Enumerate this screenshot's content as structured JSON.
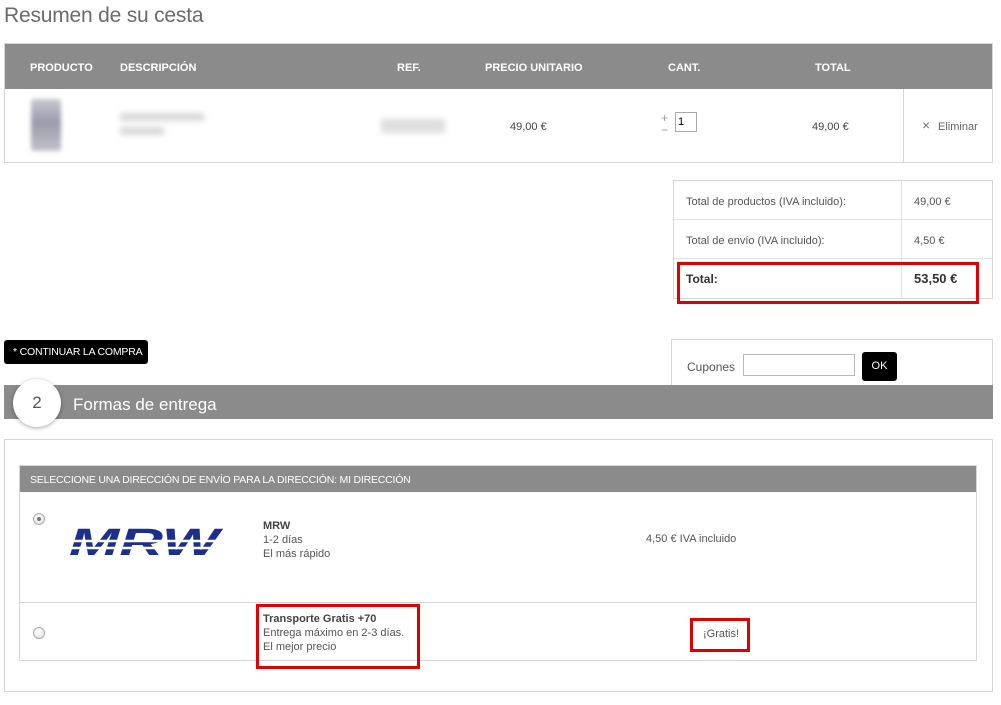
{
  "page": {
    "title": "Resumen de su cesta"
  },
  "cart": {
    "headers": [
      "PRODUCTO",
      "DESCRIPCIÓN",
      "REF.",
      "PRECIO UNITARIO",
      "CANT.",
      "TOTAL"
    ],
    "items": [
      {
        "unit_price": "49,00 €",
        "quantity": "1",
        "total": "49,00 €",
        "remove_label": "Eliminar",
        "plus": "+",
        "minus": "−",
        "remove_icon": "×"
      }
    ]
  },
  "summary": {
    "products_label": "Total de productos (IVA incluido):",
    "products_value": "49,00 €",
    "shipping_label": "Total de envío (IVA incluido):",
    "shipping_value": "4,50 €",
    "total_label": "Total:",
    "total_value": "53,50 €"
  },
  "actions": {
    "continue_label": "* CONTINUAR LA COMPRA"
  },
  "coupon": {
    "label": "Cupones",
    "value": "",
    "ok_label": "OK"
  },
  "delivery": {
    "step_number": "2",
    "section_title": "Formas de entrega",
    "header": "SELECCIONE UNA DIRECCIÓN DE ENVÍO PARA LA DIRECCIÓN: MI DIRECCIÓN",
    "options": [
      {
        "name": "MRW",
        "line1": "1-2 días",
        "line2": "El más rápido",
        "price": "4,50 € IVA incluido",
        "selected": true,
        "logo_text": "MRW"
      },
      {
        "name": "Transporte Gratis +70",
        "line1": "Entrega máximo en 2-3 días.",
        "line2": "El mejor precio",
        "price": "¡Gratis!",
        "selected": false
      }
    ]
  },
  "colors": {
    "header_gray": "#8b8b8b",
    "highlight_red": "#e00000",
    "logo_blue": "#1c2f8c"
  }
}
